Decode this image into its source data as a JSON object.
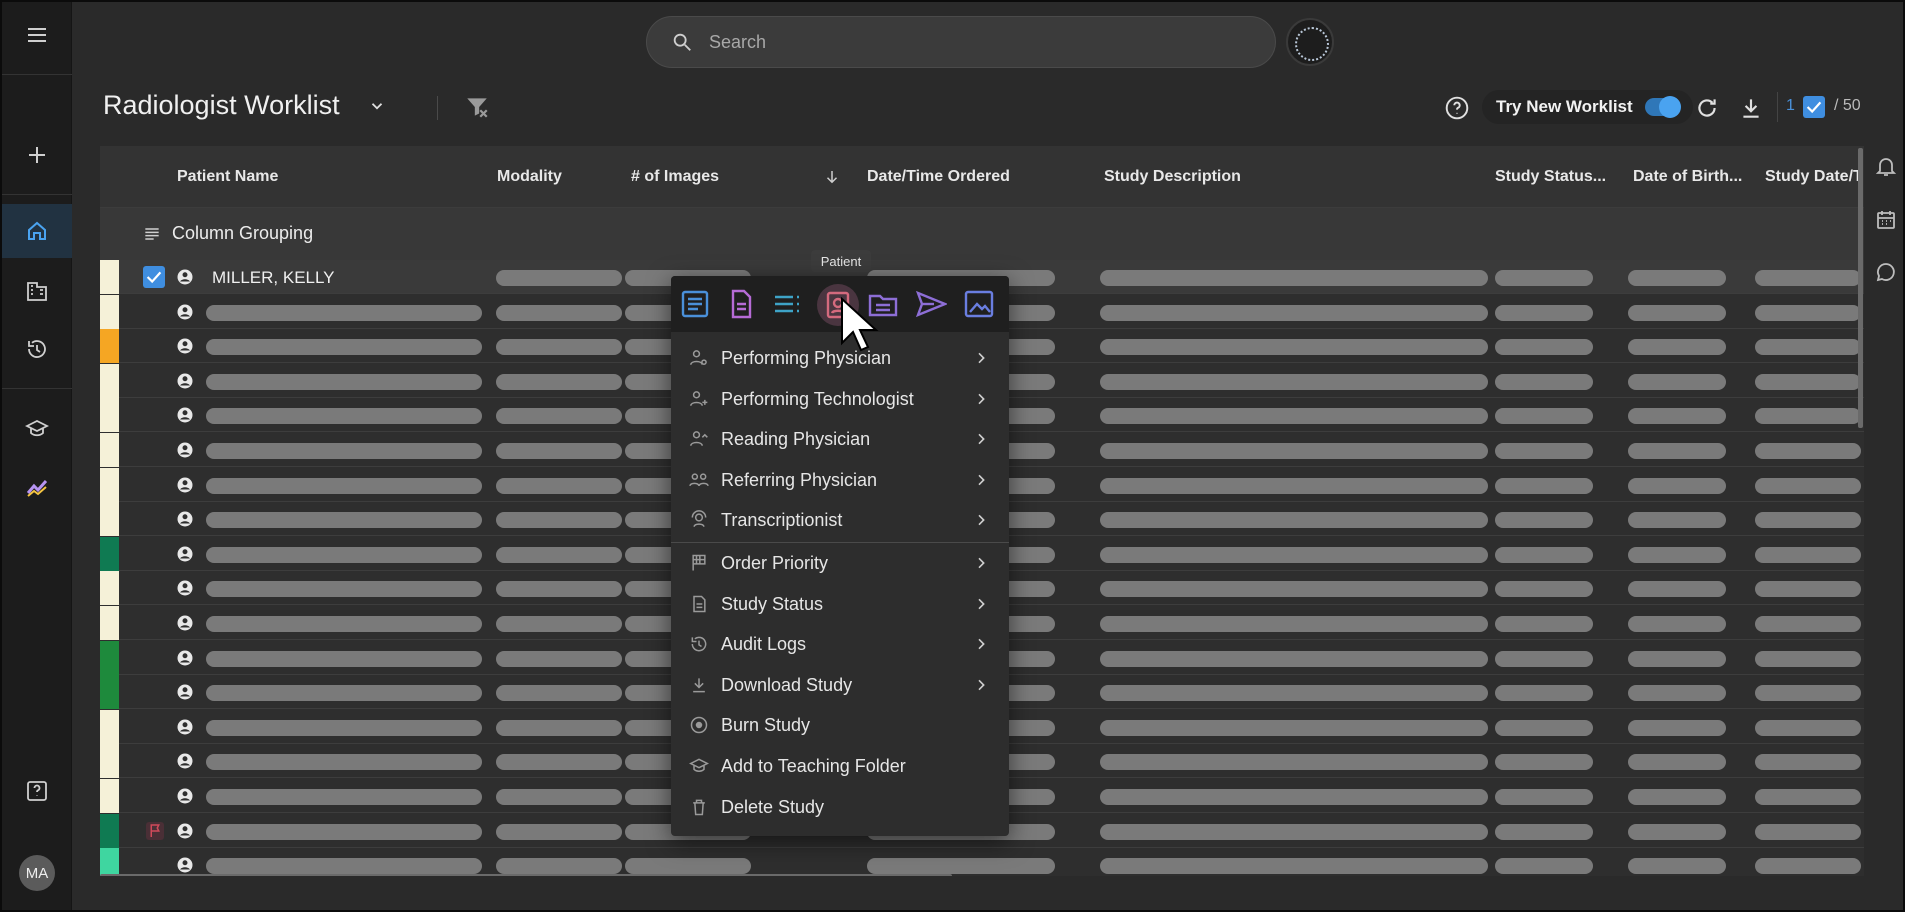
{
  "rail": {
    "avatar_initials": "MA"
  },
  "search": {
    "placeholder": "Search"
  },
  "header": {
    "title": "Radiologist Worklist",
    "try_new_label": "Try New Worklist",
    "selected_count": "1",
    "total_count": "/ 50"
  },
  "grid": {
    "columns": [
      "Patient Name",
      "Modality",
      "# of Images",
      "Date/Time Ordered",
      "Study Description",
      "Study Status...",
      "Date of Birth...",
      "Study Date/T"
    ],
    "grouping_label": "Column Grouping",
    "first_row_patient": "MILLER, KELLY",
    "row_stripe_colors": [
      "#f5f1d8",
      "#f5f1d8",
      "#f5a623",
      "#f5f1d8",
      "#f5f1d8",
      "#f5f1d8",
      "#f5f1d8",
      "#f5f1d8",
      "#0f7a52",
      "#f5f1d8",
      "#f5f1d8",
      "#1e8a3c",
      "#1e8a3c",
      "#f5f1d8",
      "#f5f1d8",
      "#f5f1d8",
      "#0f7a52",
      "#3fd6a0"
    ]
  },
  "context_menu": {
    "tooltip": "Patient",
    "items": [
      {
        "label": "Performing Physician",
        "icon": "physician-icon",
        "submenu": true
      },
      {
        "label": "Performing Technologist",
        "icon": "technologist-icon",
        "submenu": true
      },
      {
        "label": "Reading Physician",
        "icon": "reading-physician-icon",
        "submenu": true
      },
      {
        "label": "Referring Physician",
        "icon": "referring-physician-icon",
        "submenu": true
      },
      {
        "label": "Transcriptionist",
        "icon": "transcriptionist-icon",
        "submenu": true
      },
      {
        "label": "Order Priority",
        "icon": "flag-checkered-icon",
        "submenu": true
      },
      {
        "label": "Study Status",
        "icon": "document-icon",
        "submenu": true
      },
      {
        "label": "Audit Logs",
        "icon": "history-icon",
        "submenu": true
      },
      {
        "label": "Download Study",
        "icon": "download-icon",
        "submenu": true
      },
      {
        "label": "Burn Study",
        "icon": "disc-icon",
        "submenu": false
      },
      {
        "label": "Add to Teaching Folder",
        "icon": "teaching-icon",
        "submenu": false
      },
      {
        "label": "Delete Study",
        "icon": "trash-icon",
        "submenu": false
      }
    ]
  },
  "colors": {
    "accent": "#3f8ee0",
    "background": "#2a2a2a",
    "menu_bg": "#2d2d2d"
  }
}
